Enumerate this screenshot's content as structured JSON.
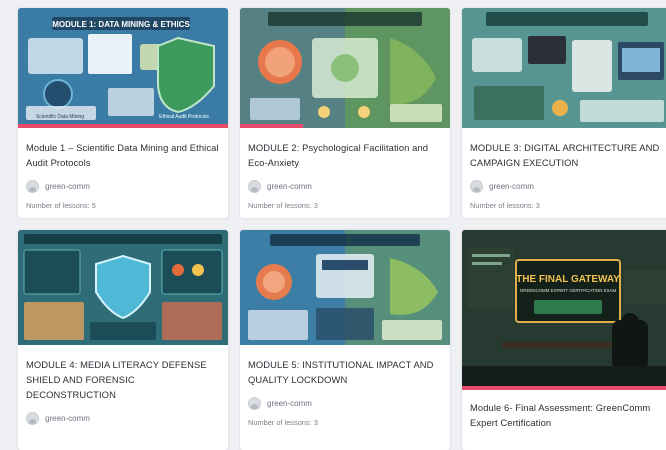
{
  "cards": [
    {
      "title": "Module 1 – Scientific Data Mining and Ethical Audit Protocols",
      "author": "green-comm",
      "lessons": "Number of lessons: 5",
      "progress": 1.0,
      "thumb": {
        "banner": "MODULE 1: DATA MINING & ETHICS",
        "label_left": "Scientific Data Mining",
        "label_right": "Ethical Audit Protocols",
        "theme": "#3f7fa8"
      }
    },
    {
      "title": "MODULE 2: Psychological Facilitation and Eco-Anxiety",
      "author": "green-comm",
      "lessons": "Number of lessons: 3",
      "progress": 0.3,
      "thumb": {
        "banner": "",
        "theme": "#5a8f5e"
      }
    },
    {
      "title": "MODULE 3: DIGITAL ARCHITECTURE AND CAMPAIGN EXECUTION",
      "author": "green-comm",
      "lessons": "Number of lessons: 3",
      "progress": 0,
      "thumb": {
        "banner": "",
        "theme": "#4d8c8a"
      }
    },
    {
      "title": "MODULE 4: MEDIA LITERACY DEFENSE SHIELD AND FORENSIC DECONSTRUCTION",
      "author": "green-comm",
      "lessons": "",
      "progress": 0,
      "thumb": {
        "banner": "",
        "theme": "#2f6d78"
      }
    },
    {
      "title": "MODULE 5: INSTITUTIONAL IMPACT AND QUALITY LOCKDOWN",
      "author": "green-comm",
      "lessons": "Number of lessons: 3",
      "progress": 0,
      "thumb": {
        "banner": "",
        "theme": "#3f7fa8"
      }
    },
    {
      "title": "Module 6- Final Assessment: GreenComm Expert Certification",
      "author": "",
      "lessons": "",
      "progress": 1.0,
      "thumb": {
        "banner": "THE FINAL GATEWAY",
        "sub": "GREENCOMM EXPERT CERTIFICATION EXAM",
        "theme": "#22332c"
      }
    }
  ],
  "colors": {
    "progress": "#e84b6a",
    "text": "#2b2f36",
    "muted": "#6d7380"
  }
}
